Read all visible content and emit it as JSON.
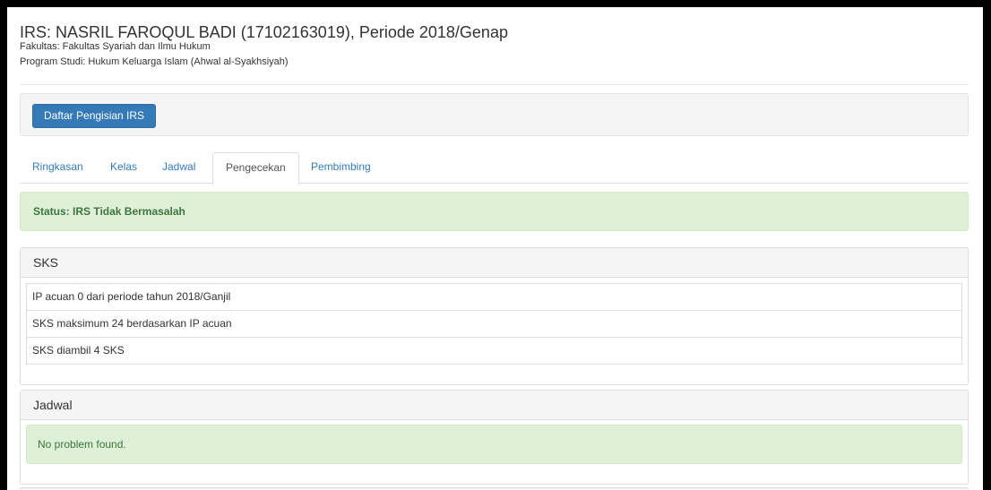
{
  "header": {
    "title": "IRS: NASRIL FAROQUL BADI (17102163019), Periode 2018/Genap",
    "fakultas": "Fakultas: Fakultas Syariah dan Ilmu Hukum",
    "prodi": "Program Studi: Hukum Keluarga Islam (Ahwal al-Syakhsiyah)"
  },
  "toolbar": {
    "daftar_label": "Daftar Pengisian IRS"
  },
  "tabs": [
    {
      "label": "Ringkasan"
    },
    {
      "label": "Kelas"
    },
    {
      "label": "Jadwal"
    },
    {
      "label": "Pengecekan",
      "active": true
    },
    {
      "label": "Pembimbing"
    }
  ],
  "status": {
    "text": "Status: IRS Tidak Bermasalah"
  },
  "sks_panel": {
    "title": "SKS",
    "items": [
      "IP acuan 0 dari periode tahun 2018/Ganjil",
      "SKS maksimum 24 berdasarkan IP acuan",
      "SKS diambil 4 SKS"
    ]
  },
  "jadwal_panel": {
    "title": "Jadwal",
    "message": "No problem found."
  },
  "colors": {
    "primary": "#337ab7",
    "success_bg": "#dff0d8",
    "success_text": "#3c763d"
  }
}
